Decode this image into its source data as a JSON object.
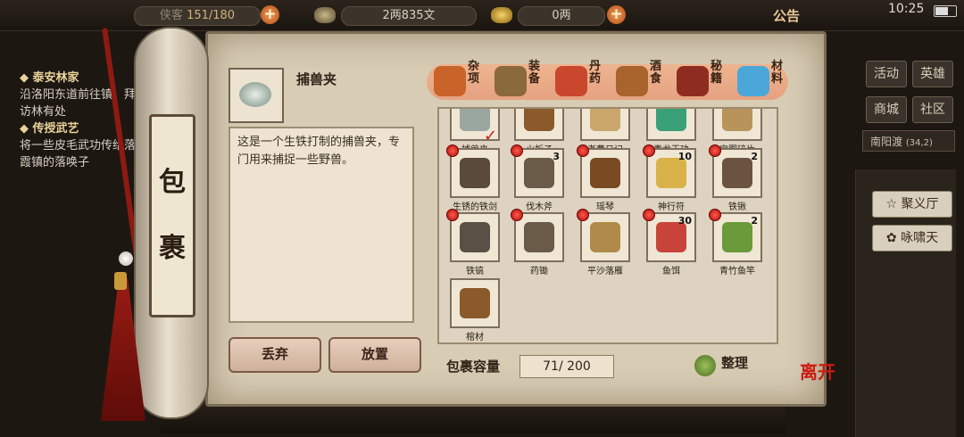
{
  "topbar": {
    "capacity_prefix": "侠客",
    "capacity": "151/180",
    "currency_a": "2两835文",
    "currency_b": "0两",
    "announcement": "公告",
    "clock": "10:25"
  },
  "quests": [
    {
      "title": "泰安林家",
      "text": "沿洛阳东道前往镇，拜访林有处"
    },
    {
      "title": "传授武艺",
      "text": "将一些皮毛武功传给落霞镇的落唤子"
    }
  ],
  "scroll_title": [
    "包",
    "裹"
  ],
  "selected_item": {
    "name": "捕兽夹",
    "description": "这是一个生铁打制的捕兽夹，专门用来捕捉一些野兽。"
  },
  "tabs": [
    {
      "label": "杂项",
      "icon": "pot-icon",
      "color": "#c8632a"
    },
    {
      "label": "装备",
      "icon": "weapon-rack-icon",
      "color": "#8a6a3a"
    },
    {
      "label": "丹药",
      "icon": "pills-icon",
      "color": "#c9472c"
    },
    {
      "label": "酒食",
      "icon": "wine-food-icon",
      "color": "#a8642c"
    },
    {
      "label": "秘籍",
      "icon": "books-icon",
      "color": "#8f2c22"
    },
    {
      "label": "材料",
      "icon": "crystal-icon",
      "color": "#4aa7d8"
    }
  ],
  "inventory": [
    {
      "name": "捕兽夹",
      "count": "",
      "dot": false,
      "icon": "trap-icon",
      "color": "#9aa6a0"
    },
    {
      "name": "火折子",
      "count": "",
      "dot": false,
      "icon": "firestarter-icon",
      "color": "#8a5a2a"
    },
    {
      "name": "老曹日记",
      "count": "",
      "dot": false,
      "icon": "diary-icon",
      "color": "#c9a66a"
    },
    {
      "name": "青龙玉玦",
      "count": "",
      "dot": false,
      "icon": "jade-icon",
      "color": "#3aa078"
    },
    {
      "name": "宝图碎片",
      "count": "",
      "dot": false,
      "icon": "map-icon",
      "color": "#b8935a"
    },
    {
      "name": "生锈的铁剑",
      "count": "",
      "dot": true,
      "icon": "sword-icon",
      "color": "#5a4a3a"
    },
    {
      "name": "伐木斧",
      "count": "3",
      "dot": true,
      "icon": "axe-icon",
      "color": "#6a5a48"
    },
    {
      "name": "瑶琴",
      "count": "",
      "dot": true,
      "icon": "zither-icon",
      "color": "#7a4a22"
    },
    {
      "name": "神行符",
      "count": "10",
      "dot": true,
      "icon": "talisman-icon",
      "color": "#d8b248"
    },
    {
      "name": "铁锹",
      "count": "2",
      "dot": true,
      "icon": "shovel-icon",
      "color": "#6a5440"
    },
    {
      "name": "铁镐",
      "count": "",
      "dot": true,
      "icon": "pickaxe-icon",
      "color": "#5a5046"
    },
    {
      "name": "药锄",
      "count": "",
      "dot": true,
      "icon": "hoe-icon",
      "color": "#6a5a48"
    },
    {
      "name": "平沙落雁",
      "count": "",
      "dot": true,
      "icon": "manual-icon",
      "color": "#b08a4a"
    },
    {
      "name": "鱼饵",
      "count": "30",
      "dot": true,
      "icon": "worm-icon",
      "color": "#c8443a"
    },
    {
      "name": "青竹鱼竿",
      "count": "2",
      "dot": true,
      "icon": "fishing-rod-icon",
      "color": "#6a9a3a"
    },
    {
      "name": "棺材",
      "count": "",
      "dot": false,
      "icon": "coffin-icon",
      "color": "#8a5a2a"
    }
  ],
  "buttons": {
    "discard": "丢弃",
    "place": "放置",
    "sort": "整理",
    "leave": "离开"
  },
  "capacity": {
    "label": "包裹容量",
    "value": "71/ 200"
  },
  "right_menu": [
    "活动",
    "英雄",
    "商城",
    "社区"
  ],
  "location": {
    "name": "南阳渡",
    "coords": "(34,2)"
  },
  "right_panel": [
    "聚义厅",
    "咏啸天"
  ]
}
